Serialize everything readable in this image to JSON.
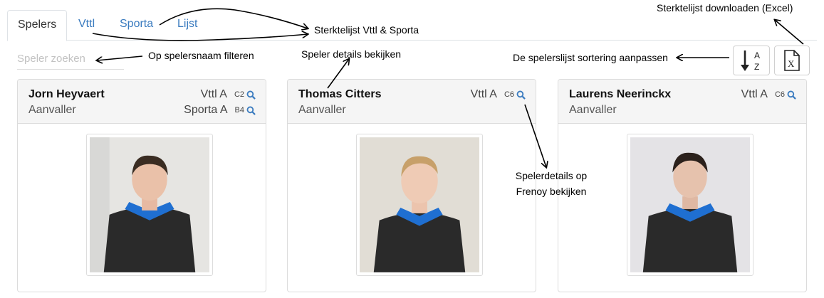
{
  "tabs": [
    {
      "label": "Spelers",
      "active": true
    },
    {
      "label": "Vttl",
      "active": false
    },
    {
      "label": "Sporta",
      "active": false
    },
    {
      "label": "Lijst",
      "active": false
    }
  ],
  "search": {
    "placeholder": "Speler zoeken",
    "value": ""
  },
  "toolbar": {
    "sort_icon": "sort-alpha-icon",
    "sort_letters": {
      "top": "A",
      "bottom": "Z"
    },
    "excel_icon": "excel-file-icon",
    "excel_letter": "X"
  },
  "players": [
    {
      "name": "Jorn Heyvaert",
      "role": "Aanvaller",
      "teams": [
        {
          "team": "Vttl A",
          "rank": "C2"
        },
        {
          "team": "Sporta A",
          "rank": "B4"
        }
      ]
    },
    {
      "name": "Thomas Citters",
      "role": "Aanvaller",
      "teams": [
        {
          "team": "Vttl A",
          "rank": "C6"
        }
      ]
    },
    {
      "name": "Laurens Neerinckx",
      "role": "Aanvaller",
      "teams": [
        {
          "team": "Vttl A",
          "rank": "C6"
        }
      ]
    }
  ],
  "annotations": {
    "download": "Sterktelijst downloaden (Excel)",
    "sterktelijst": "Sterktelijst Vttl & Sporta",
    "filter": "Op spelersnaam filteren",
    "details": "Speler details bekijken",
    "sort": "De spelerslijst sortering aanpassen",
    "frenoy_line1": "Spelerdetails op",
    "frenoy_line2": "Frenoy bekijken"
  },
  "colors": {
    "link": "#3a7bbf",
    "card_header": "#f5f5f5",
    "jersey": "#2a2a2a",
    "jersey_accent": "#1f6fd1"
  }
}
